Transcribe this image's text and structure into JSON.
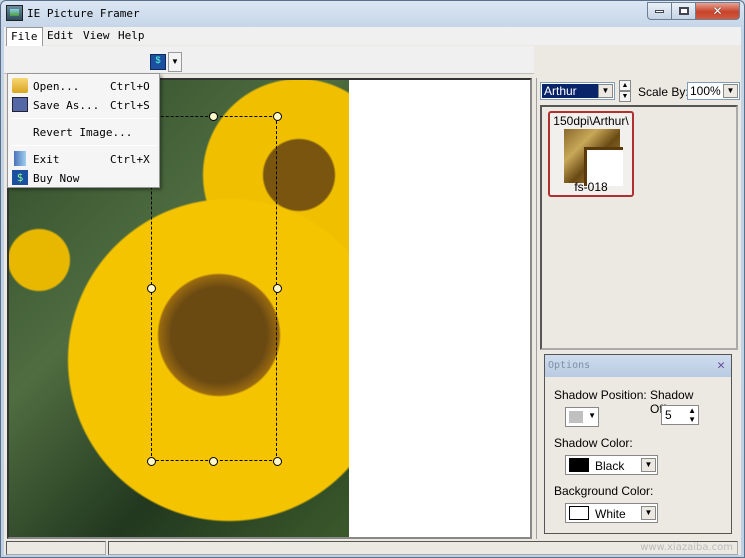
{
  "window": {
    "title": "IE Picture Framer"
  },
  "menubar": {
    "items": [
      "File",
      "Edit",
      "View",
      "Help"
    ],
    "active": "File"
  },
  "file_menu": {
    "items": [
      {
        "label": "Open...",
        "shortcut": "Ctrl+O",
        "icon": "open-folder-icon"
      },
      {
        "label": "Save As...",
        "shortcut": "Ctrl+S",
        "icon": "floppy-disk-icon"
      },
      {
        "label": "Revert Image...",
        "shortcut": "",
        "icon": ""
      },
      {
        "label": "Exit",
        "shortcut": "Ctrl+X",
        "icon": "exit-door-icon"
      },
      {
        "label": "Buy Now",
        "shortcut": "",
        "icon": "dollar-icon"
      }
    ]
  },
  "caption": {
    "minimize": "_",
    "maximize": "□",
    "close": "✕"
  },
  "right_panel": {
    "frame_collection": "Arthur",
    "scale_label": "Scale By:",
    "scale_value": "100%",
    "frames": [
      {
        "path": "150dpi\\Arthur\\",
        "name": "fs-018"
      }
    ]
  },
  "options": {
    "title": "Options",
    "shadow_position_label": "Shadow Position:",
    "shadow_offset_label": "Shadow Offset:",
    "shadow_offset_value": "5",
    "shadow_color_label": "Shadow Color:",
    "shadow_color_value": "Black",
    "shadow_color_hex": "#000000",
    "background_color_label": "Background Color:",
    "background_color_value": "White",
    "background_color_hex": "#ffffff"
  },
  "watermark": "www.xiazaiba.com"
}
